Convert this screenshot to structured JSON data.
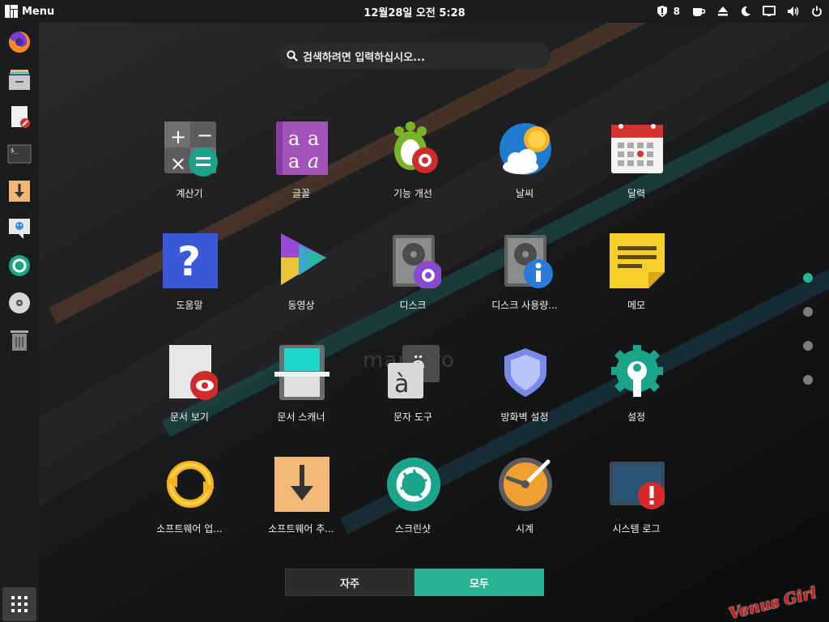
{
  "topbar": {
    "menu_label": "Menu",
    "clock": "12월28일 오전 5:28",
    "updates_count": "8"
  },
  "search": {
    "placeholder": "검색하려면 입력하십시오..."
  },
  "dock": {
    "items": [
      "firefox-icon",
      "files-icon",
      "text-editor-icon",
      "terminal-icon",
      "software-install-icon",
      "chat-icon",
      "screenshot-icon",
      "disc-icon",
      "trash-icon"
    ]
  },
  "apps": [
    {
      "label": "계산기",
      "icon": "calculator-icon"
    },
    {
      "label": "글꼴",
      "icon": "fonts-icon"
    },
    {
      "label": "기능 개선",
      "icon": "tweaks-icon"
    },
    {
      "label": "날씨",
      "icon": "weather-icon"
    },
    {
      "label": "달력",
      "icon": "calendar-icon"
    },
    {
      "label": "도움말",
      "icon": "help-icon"
    },
    {
      "label": "동영상",
      "icon": "videos-icon"
    },
    {
      "label": "디스크",
      "icon": "disks-icon"
    },
    {
      "label": "디스크 사용량...",
      "icon": "disk-usage-icon"
    },
    {
      "label": "메모",
      "icon": "notes-icon"
    },
    {
      "label": "문서 보기",
      "icon": "document-viewer-icon"
    },
    {
      "label": "문서 스캐너",
      "icon": "scanner-icon"
    },
    {
      "label": "문자 도구",
      "icon": "characters-icon"
    },
    {
      "label": "방화벽 설정",
      "icon": "firewall-icon"
    },
    {
      "label": "설정",
      "icon": "settings-icon"
    },
    {
      "label": "소프트웨어 업...",
      "icon": "software-update-icon"
    },
    {
      "label": "소프트웨어 추...",
      "icon": "software-add-icon"
    },
    {
      "label": "스크린샷",
      "icon": "screenshot-icon"
    },
    {
      "label": "시계",
      "icon": "clocks-icon"
    },
    {
      "label": "시스템 로그",
      "icon": "system-log-icon"
    }
  ],
  "tabs": {
    "frequent": "자주",
    "all": "모두"
  },
  "background_logo": "manjaro",
  "watermark": "Venus Girl",
  "colors": {
    "accent": "#2ab294",
    "panel": "#1b1c1d"
  }
}
